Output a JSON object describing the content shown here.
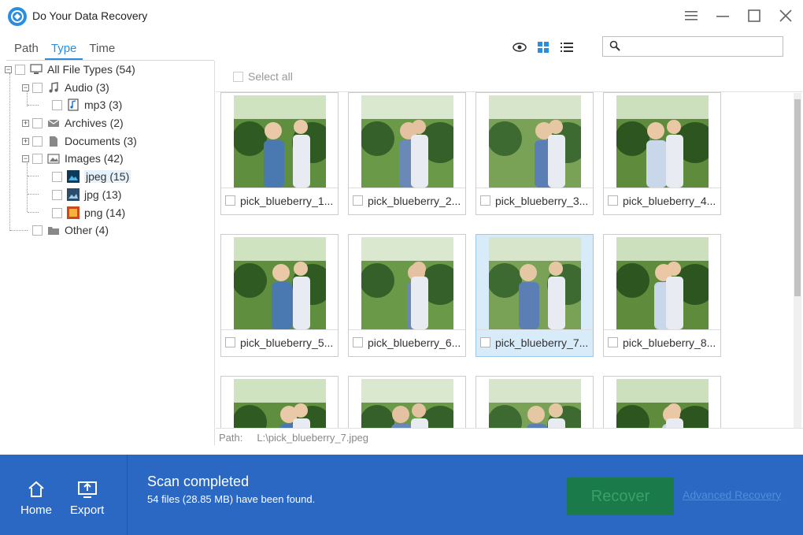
{
  "app": {
    "title": "Do Your Data Recovery",
    "icon": "app-logo-icon"
  },
  "window_controls": {
    "menu_icon": "hamburger-menu-icon",
    "minimize_icon": "minimize-icon",
    "maximize_icon": "maximize-icon",
    "close_icon": "close-icon"
  },
  "tabs": [
    {
      "label": "Path",
      "active": false
    },
    {
      "label": "Type",
      "active": true
    },
    {
      "label": "Time",
      "active": false
    }
  ],
  "view_modes": [
    "preview-eye-icon",
    "grid-view-icon",
    "list-view-icon"
  ],
  "search": {
    "value": "",
    "placeholder": "",
    "icon": "search-icon"
  },
  "tree": {
    "root": "All File Types (54)",
    "audio": "Audio (3)",
    "mp3": "mp3 (3)",
    "archives": "Archives (2)",
    "documents": "Documents (3)",
    "images": "Images (42)",
    "jpeg": "jpeg (15)",
    "jpg": "jpg (13)",
    "png": "png (14)",
    "other": "Other (4)"
  },
  "select_all": "Select all",
  "files": [
    {
      "name": "pick_blueberry_1...",
      "selected": false
    },
    {
      "name": "pick_blueberry_2...",
      "selected": false
    },
    {
      "name": "pick_blueberry_3...",
      "selected": false
    },
    {
      "name": "pick_blueberry_4...",
      "selected": false
    },
    {
      "name": "pick_blueberry_5...",
      "selected": false
    },
    {
      "name": "pick_blueberry_6...",
      "selected": false
    },
    {
      "name": "pick_blueberry_7...",
      "selected": true
    },
    {
      "name": "pick_blueberry_8...",
      "selected": false
    },
    {
      "name": "",
      "selected": false
    },
    {
      "name": "",
      "selected": false
    },
    {
      "name": "",
      "selected": false
    },
    {
      "name": "",
      "selected": false
    }
  ],
  "path_bar": {
    "label": "Path:",
    "value": "L:\\pick_blueberry_7.jpeg"
  },
  "footer": {
    "home_label": "Home",
    "export_label": "Export",
    "status_title": "Scan completed",
    "status_detail": "54 files (28.85 MB) have been found.",
    "recover_label": "Recover",
    "advanced_label": "Advanced Recovery"
  },
  "colors": {
    "accent": "#2a8de0",
    "footer_bg": "#2a68c3",
    "recover_bg": "#1a7a4a"
  }
}
